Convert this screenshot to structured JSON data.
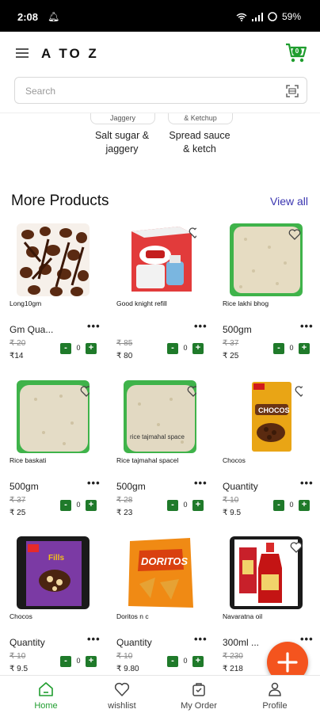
{
  "status_bar": {
    "time": "2:08",
    "battery": "59%"
  },
  "app": {
    "title": "A TO Z",
    "cart_count": "0"
  },
  "search": {
    "placeholder": "Search"
  },
  "categories": [
    {
      "chip": "Jaggery",
      "name_line1": "Salt sugar &",
      "name_line2": "jaggery"
    },
    {
      "chip": "& Ketchup",
      "name_line1": "Spread sauce",
      "name_line2": "& ketch"
    }
  ],
  "section": {
    "title": "More Products",
    "view_all": "View all"
  },
  "products": [
    {
      "name": "Long10gm",
      "qty": "Gm Qua...",
      "mrp": "₹ 20",
      "price": "₹14",
      "count": "0"
    },
    {
      "name": "Good knight refill",
      "qty": "",
      "mrp": "₹ 85",
      "price": "₹ 80",
      "count": "0"
    },
    {
      "name": "Rice lakhi bhog",
      "qty": "500gm",
      "mrp": "₹ 37",
      "price": "₹ 25",
      "count": "0"
    },
    {
      "name": "Rice baskati",
      "qty": "500gm",
      "mrp": "₹ 37",
      "price": "₹ 25",
      "count": "0"
    },
    {
      "name": "Rice tajmahal spacel",
      "qty": "500gm",
      "mrp": "₹ 28",
      "price": "₹ 23",
      "count": "0",
      "img_caption": "rice tajmahal space"
    },
    {
      "name": "Chocos",
      "qty": "Quantity",
      "mrp": "₹ 10",
      "price": "₹ 9.5",
      "count": "0",
      "img_caption": "CHOCOS"
    },
    {
      "name": "Chocos",
      "qty": "Quantity",
      "mrp": "₹ 10",
      "price": "₹ 9.5",
      "count": "0",
      "img_caption": "Fills"
    },
    {
      "name": "Doritos n c",
      "qty": "Quantity",
      "mrp": "₹ 10",
      "price": "₹ 9.80",
      "count": "0",
      "img_caption": "DORITOS"
    },
    {
      "name": "Navaratna oil",
      "qty": "300ml ...",
      "mrp": "₹ 230",
      "price": "₹ 218",
      "count": "0"
    }
  ],
  "controls": {
    "more": "•••",
    "minus": "-",
    "plus": "+"
  },
  "bottom_nav": [
    {
      "label": "Home",
      "active": true
    },
    {
      "label": "wishlist"
    },
    {
      "label": "My Order"
    },
    {
      "label": "Profile"
    }
  ],
  "colors": {
    "brand_green": "#1f9d2e",
    "button_green": "#1f7a2a",
    "fab_orange": "#f4541e",
    "link_purple": "#3a35b0"
  }
}
